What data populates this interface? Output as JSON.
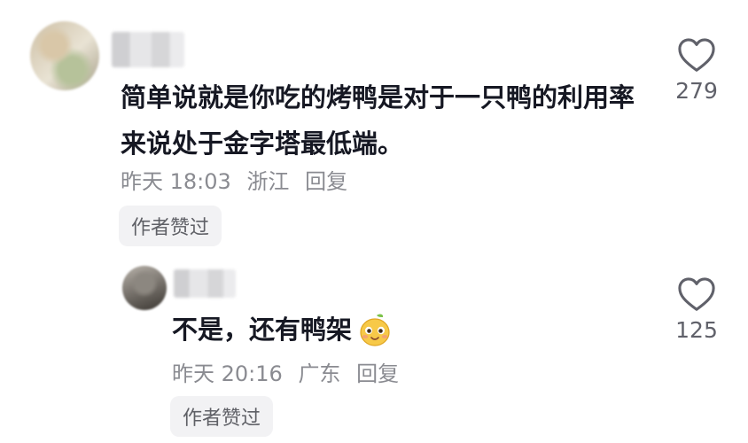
{
  "comment": {
    "text": "简单说就是你吃的烤鸭是对于一只鸭的利用率来说处于金字塔最低端。",
    "time": "昨天 18:03",
    "location": "浙江",
    "reply_label": "回复",
    "badge": "作者赞过",
    "likes": "279",
    "like_icon": "heart-outline-icon"
  },
  "reply": {
    "text": "不是，还有鸭架",
    "emoji_icon": "mango-face-emoji-icon",
    "time": "昨天 20:16",
    "location": "广东",
    "reply_label": "回复",
    "badge": "作者赞过",
    "likes": "125",
    "like_icon": "heart-outline-icon"
  },
  "colors": {
    "text": "#161823",
    "meta": "#8a8b91",
    "badge_bg": "#f2f2f4"
  }
}
